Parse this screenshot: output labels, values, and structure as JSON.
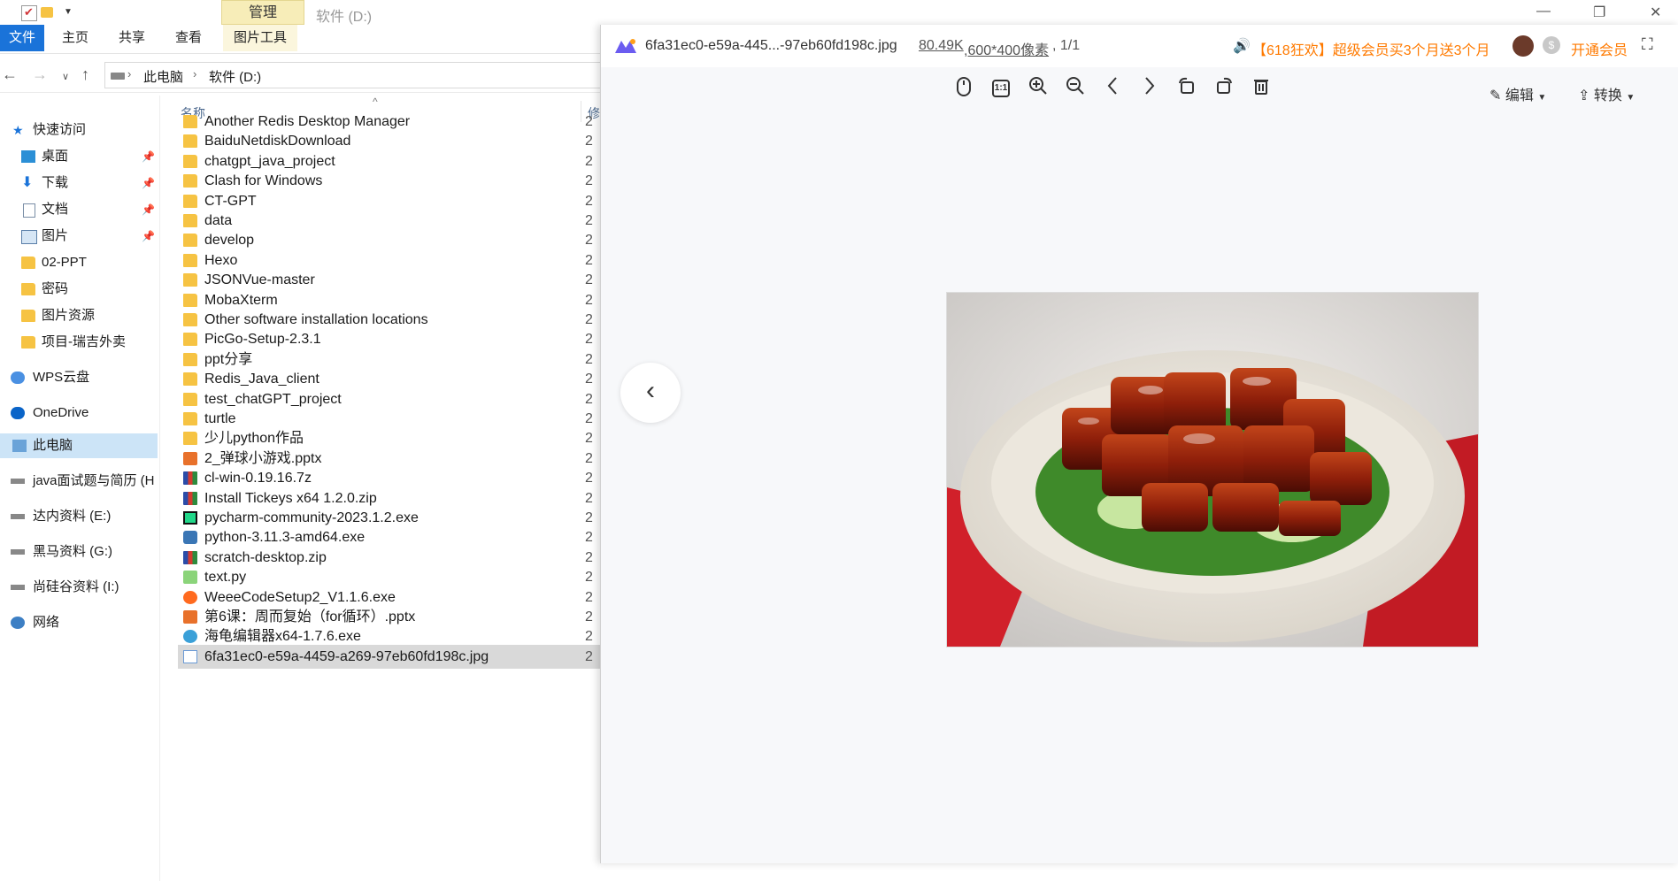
{
  "explorer": {
    "title_tab_manage": "管理",
    "title_drive": "软件 (D:)",
    "ribbon_tabs": [
      "文件",
      "主页",
      "共享",
      "查看",
      "图片工具"
    ],
    "breadcrumb": [
      "此电脑",
      "软件 (D:)"
    ],
    "nav": {
      "quick_access": "快速访问",
      "desktop": "桌面",
      "downloads": "下载",
      "documents": "文档",
      "pictures": "图片",
      "ppt": "02-PPT",
      "passwords": "密码",
      "picture_resources": "图片资源",
      "project": "项目-瑞吉外卖",
      "wps": "WPS云盘",
      "onedrive": "OneDrive",
      "this_pc": "此电脑",
      "drive_h": "java面试题与简历 (H",
      "drive_e": "达内资料 (E:)",
      "drive_g": "黑马资料 (G:)",
      "drive_i": "尚硅谷资料 (I:)",
      "network": "网络"
    },
    "columns": {
      "name": "名称",
      "modified": "修"
    },
    "files": [
      {
        "name": "Another Redis Desktop Manager",
        "date": "2",
        "type": "folder"
      },
      {
        "name": "BaiduNetdiskDownload",
        "date": "2",
        "type": "folder"
      },
      {
        "name": "chatgpt_java_project",
        "date": "2",
        "type": "folder"
      },
      {
        "name": "Clash for Windows",
        "date": "2",
        "type": "folder"
      },
      {
        "name": "CT-GPT",
        "date": "2",
        "type": "folder"
      },
      {
        "name": "data",
        "date": "2",
        "type": "folder"
      },
      {
        "name": "develop",
        "date": "2",
        "type": "folder"
      },
      {
        "name": "Hexo",
        "date": "2",
        "type": "folder"
      },
      {
        "name": "JSONVue-master",
        "date": "2",
        "type": "folder"
      },
      {
        "name": "MobaXterm",
        "date": "2",
        "type": "folder"
      },
      {
        "name": "Other software installation locations",
        "date": "2",
        "type": "folder"
      },
      {
        "name": "PicGo-Setup-2.3.1",
        "date": "2",
        "type": "folder"
      },
      {
        "name": "ppt分享",
        "date": "2",
        "type": "folder"
      },
      {
        "name": "Redis_Java_client",
        "date": "2",
        "type": "folder"
      },
      {
        "name": "test_chatGPT_project",
        "date": "2",
        "type": "folder"
      },
      {
        "name": "turtle",
        "date": "2",
        "type": "folder"
      },
      {
        "name": "少儿python作品",
        "date": "2",
        "type": "folder"
      },
      {
        "name": "2_弹球小游戏.pptx",
        "date": "2",
        "type": "ppt"
      },
      {
        "name": "cl-win-0.19.16.7z",
        "date": "2",
        "type": "zip"
      },
      {
        "name": "Install Tickeys x64 1.2.0.zip",
        "date": "2",
        "type": "zip"
      },
      {
        "name": "pycharm-community-2023.1.2.exe",
        "date": "2",
        "type": "pycharm"
      },
      {
        "name": "python-3.11.3-amd64.exe",
        "date": "2",
        "type": "python"
      },
      {
        "name": "scratch-desktop.zip",
        "date": "2",
        "type": "zip"
      },
      {
        "name": "text.py",
        "date": "2",
        "type": "pyfile"
      },
      {
        "name": "WeeeCodeSetup2_V1.1.6.exe",
        "date": "2",
        "type": "weee"
      },
      {
        "name": "第6课：周而复始（for循环）.pptx",
        "date": "2",
        "type": "ppt"
      },
      {
        "name": "海龟编辑器x64-1.7.6.exe",
        "date": "2",
        "type": "turtle"
      },
      {
        "name": "6fa31ec0-e59a-4459-a269-97eb60fd198c.jpg",
        "date": "2",
        "type": "image",
        "selected": true
      }
    ]
  },
  "viewer": {
    "filename": "6fa31ec0-e59a-445...-97eb60fd198c.jpg",
    "filesize": "80.49K",
    "dimensions": ",600*400像素",
    "page": ", 1/1",
    "promo": "【618狂欢】超级会员买3个月送3个月",
    "vip_button": "开通会员",
    "edit_label": "编辑",
    "convert_label": "转换",
    "ratio_label": "1:1"
  },
  "colors": {
    "accent": "#1a73d9",
    "promo": "#ff7a00",
    "folder": "#f6c343"
  }
}
